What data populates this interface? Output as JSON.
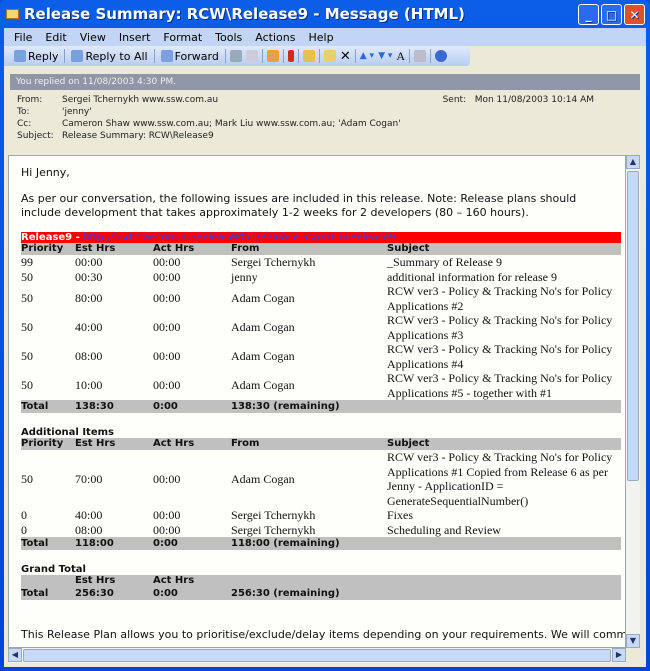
{
  "window": {
    "title": "Release Summary: RCW\\Release9 - Message (HTML)"
  },
  "menu": [
    "File",
    "Edit",
    "View",
    "Insert",
    "Format",
    "Tools",
    "Actions",
    "Help"
  ],
  "toolbar": {
    "reply": "Reply",
    "reply_all": "Reply to All",
    "forward": "Forward"
  },
  "header": {
    "info": "You replied on 11/08/2003 4:30 PM.",
    "from_label": "From:",
    "from": "Sergei Tchernykh www.ssw.com.au",
    "sent_label": "Sent:",
    "sent": "Mon 11/08/2003 10:14 AM",
    "to_label": "To:",
    "to": "'jenny'",
    "cc_label": "Cc:",
    "cc": "Cameron Shaw www.ssw.com.au; Mark Liu www.ssw.com.au; 'Adam Cogan'",
    "subject_label": "Subject:",
    "subject": "Release Summary: RCW\\Release9"
  },
  "body": {
    "greeting": "Hi Jenny,",
    "intro": "As per our conversation, the following issues are included in this release. Note: Release plans should include development that takes approximately 1-2 weeks for 2 developers (80 – 160 hours).",
    "release_title": "Release9 - ",
    "release_link": "http://bsd.ssw.com.au/ReleasePlan/Release.aspx?ID=Release9",
    "columns": [
      "Priority",
      "Est Hrs",
      "Act Hrs",
      "From",
      "Subject"
    ],
    "release_rows": [
      [
        "99",
        "00:00",
        "00:00",
        "Sergei Tchernykh",
        "_Summary of Release 9"
      ],
      [
        "50",
        "00:30",
        "00:00",
        "jenny",
        "additional information for release 9"
      ],
      [
        "50",
        "80:00",
        "00:00",
        "Adam Cogan",
        "RCW ver3 - Policy & Tracking No's for Policy Applications #2"
      ],
      [
        "50",
        "40:00",
        "00:00",
        "Adam Cogan",
        "RCW ver3 - Policy & Tracking No's for Policy Applications #3"
      ],
      [
        "50",
        "08:00",
        "00:00",
        "Adam Cogan",
        "RCW ver3 - Policy & Tracking No's for Policy Applications #4"
      ],
      [
        "50",
        "10:00",
        "00:00",
        "Adam Cogan",
        "RCW ver3 - Policy & Tracking No's for Policy Applications #5 - together with #1"
      ]
    ],
    "release_total": [
      "Total",
      "138:30",
      "0:00",
      "138:30 (remaining)",
      ""
    ],
    "additional_title": "Additional Items",
    "additional_rows": [
      [
        "50",
        "70:00",
        "00:00",
        "Adam Cogan",
        "RCW ver3 - Policy & Tracking No's for Policy Applications #1 Copied from Release 6 as per Jenny - ApplicationID = GenerateSequentialNumber()"
      ],
      [
        "0",
        "40:00",
        "00:00",
        "Sergei Tchernykh",
        "Fixes"
      ],
      [
        "0",
        "08:00",
        "00:00",
        "Sergei Tchernykh",
        "Scheduling and Review"
      ]
    ],
    "additional_total": [
      "Total",
      "118:00",
      "0:00",
      "118:00 (remaining)",
      ""
    ],
    "grand_title": "Grand Total",
    "grand_columns": [
      "",
      "Est Hrs",
      "Act Hrs",
      "",
      ""
    ],
    "grand_total": [
      "Total",
      "256:30",
      "0:00",
      "256:30 (remaining)",
      ""
    ],
    "footer": "This Release Plan allows you to prioritise/exclude/delay items depending on your requirements. We will commence"
  }
}
